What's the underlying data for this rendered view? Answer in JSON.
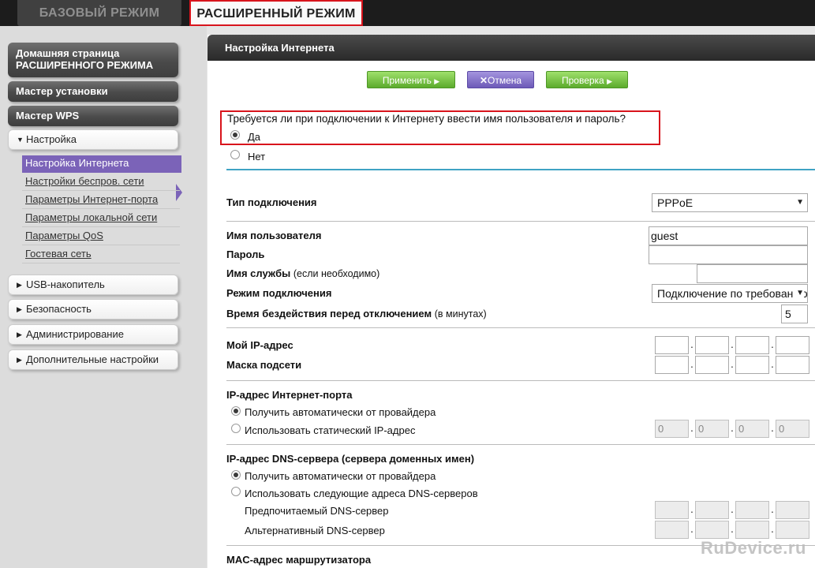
{
  "tabs": {
    "basic": "БАЗОВЫЙ РЕЖИМ",
    "advanced": "РАСШИРЕННЫЙ РЕЖИМ"
  },
  "sidebar": {
    "home_line1": "Домашняя страница",
    "home_line2": "РАСШИРЕННОГО РЕЖИМА",
    "setup_wizard": "Мастер установки",
    "wps_wizard": "Мастер WPS",
    "settings": "Настройка",
    "settings_items": [
      "Настройка Интернета",
      "Настройки беспров. сети",
      "Параметры Интернет-порта",
      "Параметры локальной сети",
      "Параметры QoS",
      "Гостевая сеть"
    ],
    "usb": "USB-накопитель",
    "security": "Безопасность",
    "admin": "Администрирование",
    "advanced_settings": "Дополнительные настройки"
  },
  "main": {
    "title": "Настройка Интернета",
    "buttons": {
      "apply": "Применить",
      "cancel": "Отмена",
      "test": "Проверка"
    },
    "question": "Требуется ли при подключении к Интернету ввести имя пользователя и пароль?",
    "answer_yes": "Да",
    "answer_no": "Нет",
    "connection_type_label": "Тип подключения",
    "connection_type_value": "PPPoE",
    "username_label": "Имя пользователя",
    "username_value": "guest",
    "password_label": "Пароль",
    "password_value": "",
    "service_label": "Имя службы",
    "service_note": "(если необходимо)",
    "service_value": "",
    "conn_mode_label": "Режим подключения",
    "conn_mode_value": "Подключение по требованию",
    "idle_label": "Время бездействия перед отключением",
    "idle_note": "(в минутах)",
    "idle_value": "5",
    "my_ip_label": "Мой IP-адрес",
    "subnet_label": "Маска подсети",
    "wan_ip_heading": "IP-адрес Интернет-порта",
    "wan_ip_auto": "Получить автоматически от провайдера",
    "wan_ip_static": "Использовать статический IP-адрес",
    "wan_ip_octets": [
      "0",
      "0",
      "0",
      "0"
    ],
    "dns_heading": "IP-адрес DNS-сервера (сервера доменных имен)",
    "dns_auto": "Получить автоматически от провайдера",
    "dns_manual": "Использовать следующие адреса DNS-серверов",
    "dns_primary": "Предпочитаемый DNS-сервер",
    "dns_alt": "Альтернативный DNS-сервер",
    "mac_heading": "MAC-адрес маршрутизатора"
  },
  "watermark": "RuDevice.ru",
  "colors": {
    "accent_red": "#d8141c",
    "active_purple": "#7b63b8",
    "button_green": "#5cab2c",
    "separator_blue": "#3fa3c4"
  }
}
